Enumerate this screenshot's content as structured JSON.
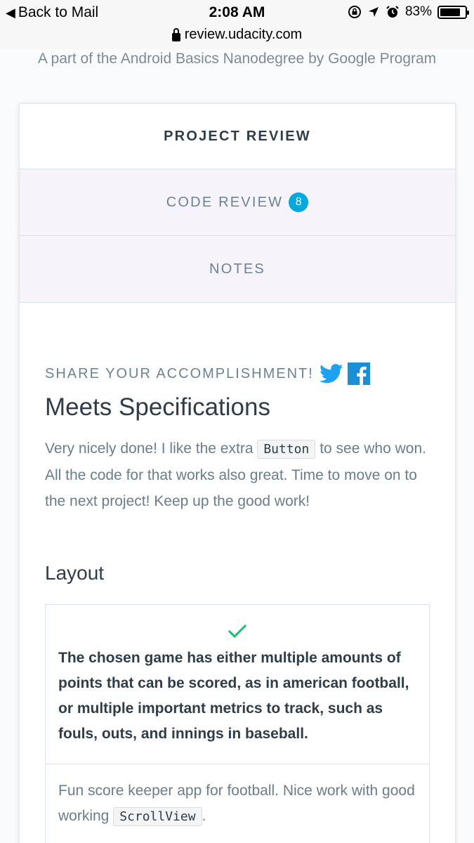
{
  "statusbar": {
    "back_label": "Back to Mail",
    "time": "2:08 AM",
    "battery": "83%",
    "battery_level": 0.83,
    "url": "review.udacity.com"
  },
  "subtitle": "A part of the Android Basics Nanodegree by Google Program",
  "tabs": [
    {
      "label": "PROJECT REVIEW",
      "active": true
    },
    {
      "label": "CODE REVIEW",
      "badge": "8",
      "active": false
    },
    {
      "label": "NOTES",
      "active": false
    }
  ],
  "share_label": "SHARE YOUR ACCOMPLISHMENT!",
  "result_title": "Meets Specifications",
  "review": {
    "part1": "Very nicely done! I like the extra ",
    "code": "Button",
    "part2": " to see who won. All the code for that works also great. Time to move on to the next project! Keep up the good work!"
  },
  "section_title": "Layout",
  "rubric": {
    "criterion": "The chosen game has either multiple amounts of points that can be scored, as in american football, or multiple important metrics to track, such as fouls, outs, and innings in baseball.",
    "comment_part1": "Fun score keeper app for football. Nice work with good working ",
    "comment_code": "ScrollView",
    "comment_part2": "."
  },
  "colors": {
    "accent": "#02a9e0",
    "check": "#15c26b",
    "twitter": "#1da1f2",
    "facebook": "#1a8fd6"
  }
}
